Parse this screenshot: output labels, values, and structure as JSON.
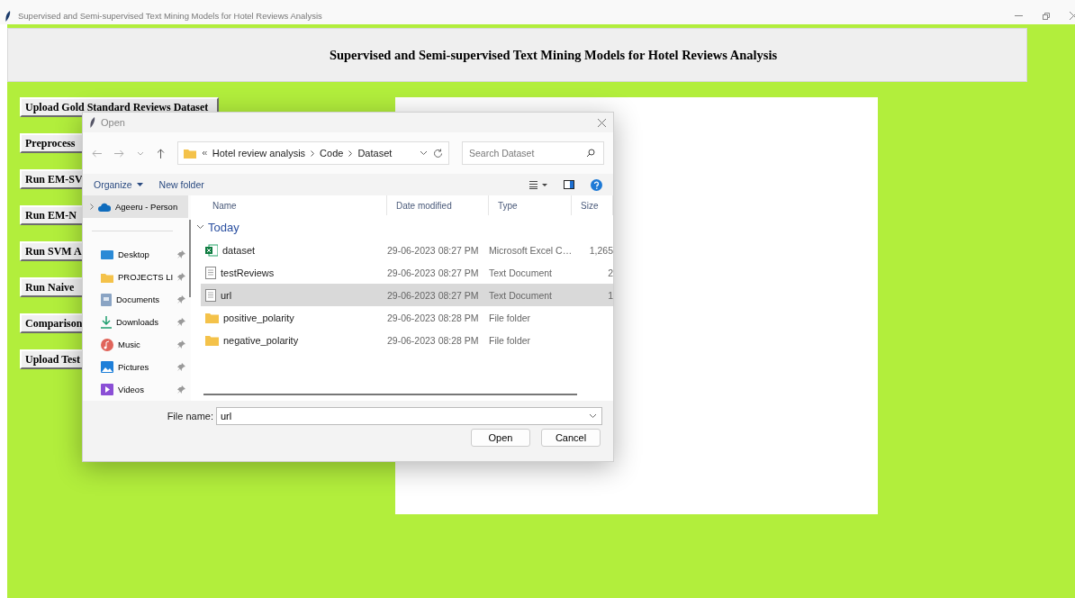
{
  "window": {
    "title": "Supervised and Semi-supervised Text Mining Models for Hotel Reviews Analysis"
  },
  "header": {
    "title": "Supervised and Semi-supervised Text Mining Models for Hotel Reviews Analysis"
  },
  "buttons": [
    {
      "label": "Upload Gold Standard Reviews Dataset"
    },
    {
      "label": "Preprocess"
    },
    {
      "label": "Run EM-SV"
    },
    {
      "label": "Run EM-N"
    },
    {
      "label": "Run SVM A"
    },
    {
      "label": "Run Naive"
    },
    {
      "label": "Comparison"
    },
    {
      "label": "Upload Test"
    }
  ],
  "dialog": {
    "title": "Open",
    "breadcrumb": [
      "Hotel review analysis",
      "Code",
      "Dataset"
    ],
    "search": {
      "placeholder": "Search Dataset"
    },
    "toolbar": [
      "Organize",
      "New folder"
    ],
    "nav_items": [
      {
        "label": "Ageeru - Person",
        "kind": "cloud",
        "selected": true
      },
      {
        "label": "Desktop",
        "kind": "desktop",
        "selected": false
      },
      {
        "label": "PROJECTS LI",
        "kind": "folder",
        "selected": false
      },
      {
        "label": "Documents",
        "kind": "documents",
        "selected": false
      },
      {
        "label": "Downloads",
        "kind": "downloads",
        "selected": false
      },
      {
        "label": "Music",
        "kind": "music",
        "selected": false
      },
      {
        "label": "Pictures",
        "kind": "pictures",
        "selected": false
      },
      {
        "label": "Videos",
        "kind": "videos",
        "selected": false
      }
    ],
    "columns": [
      "Name",
      "Date modified",
      "Type",
      "Size"
    ],
    "group": "Today",
    "files": [
      {
        "name": "dataset",
        "date": "29-06-2023 08:27 PM",
        "type": "Microsoft Excel C…",
        "size": "1,265",
        "kind": "spreadsheet",
        "selected": false
      },
      {
        "name": "testReviews",
        "date": "29-06-2023 08:27 PM",
        "type": "Text Document",
        "size": "2",
        "kind": "text",
        "selected": false
      },
      {
        "name": "url",
        "date": "29-06-2023 08:27 PM",
        "type": "Text Document",
        "size": "1",
        "kind": "text",
        "selected": true
      },
      {
        "name": "positive_polarity",
        "date": "29-06-2023 08:28 PM",
        "type": "File folder",
        "kind": "folder",
        "selected": false
      },
      {
        "name": "negative_polarity",
        "date": "29-06-2023 08:28 PM",
        "type": "File folder",
        "kind": "folder",
        "selected": false
      }
    ],
    "file_name_label": "File name:",
    "file_name": "url",
    "actions": [
      "Open",
      "Cancel"
    ]
  }
}
